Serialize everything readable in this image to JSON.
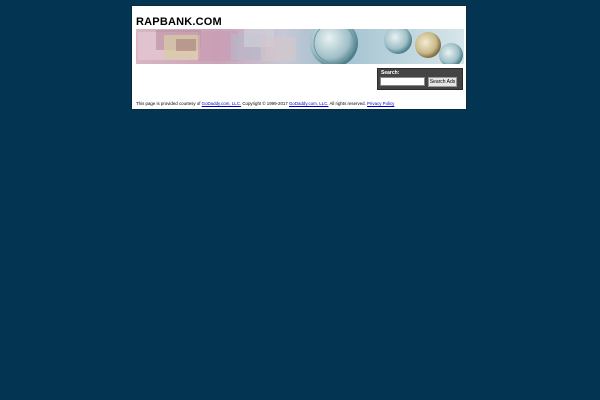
{
  "header": {
    "site_title": "RAPBANK.COM"
  },
  "search": {
    "label": "Search:",
    "input_value": "",
    "button_label": "Search Ads"
  },
  "footer": {
    "text_prefix": "This page is provided courtesy of ",
    "godaddy_link_1": "GoDaddy.com, LLC.",
    "copyright_text": " Copyright © 1999-2017 ",
    "godaddy_link_2": "GoDaddy.com, LLC.",
    "rights_text": " All rights reserved. ",
    "privacy_link": "Privacy Policy"
  },
  "colors": {
    "page_background": "#033451",
    "panel_background": "#ffffff",
    "search_box_background": "#444444",
    "link_color": "#0000cc"
  },
  "banner": {
    "icon": "currency-banner-image"
  }
}
